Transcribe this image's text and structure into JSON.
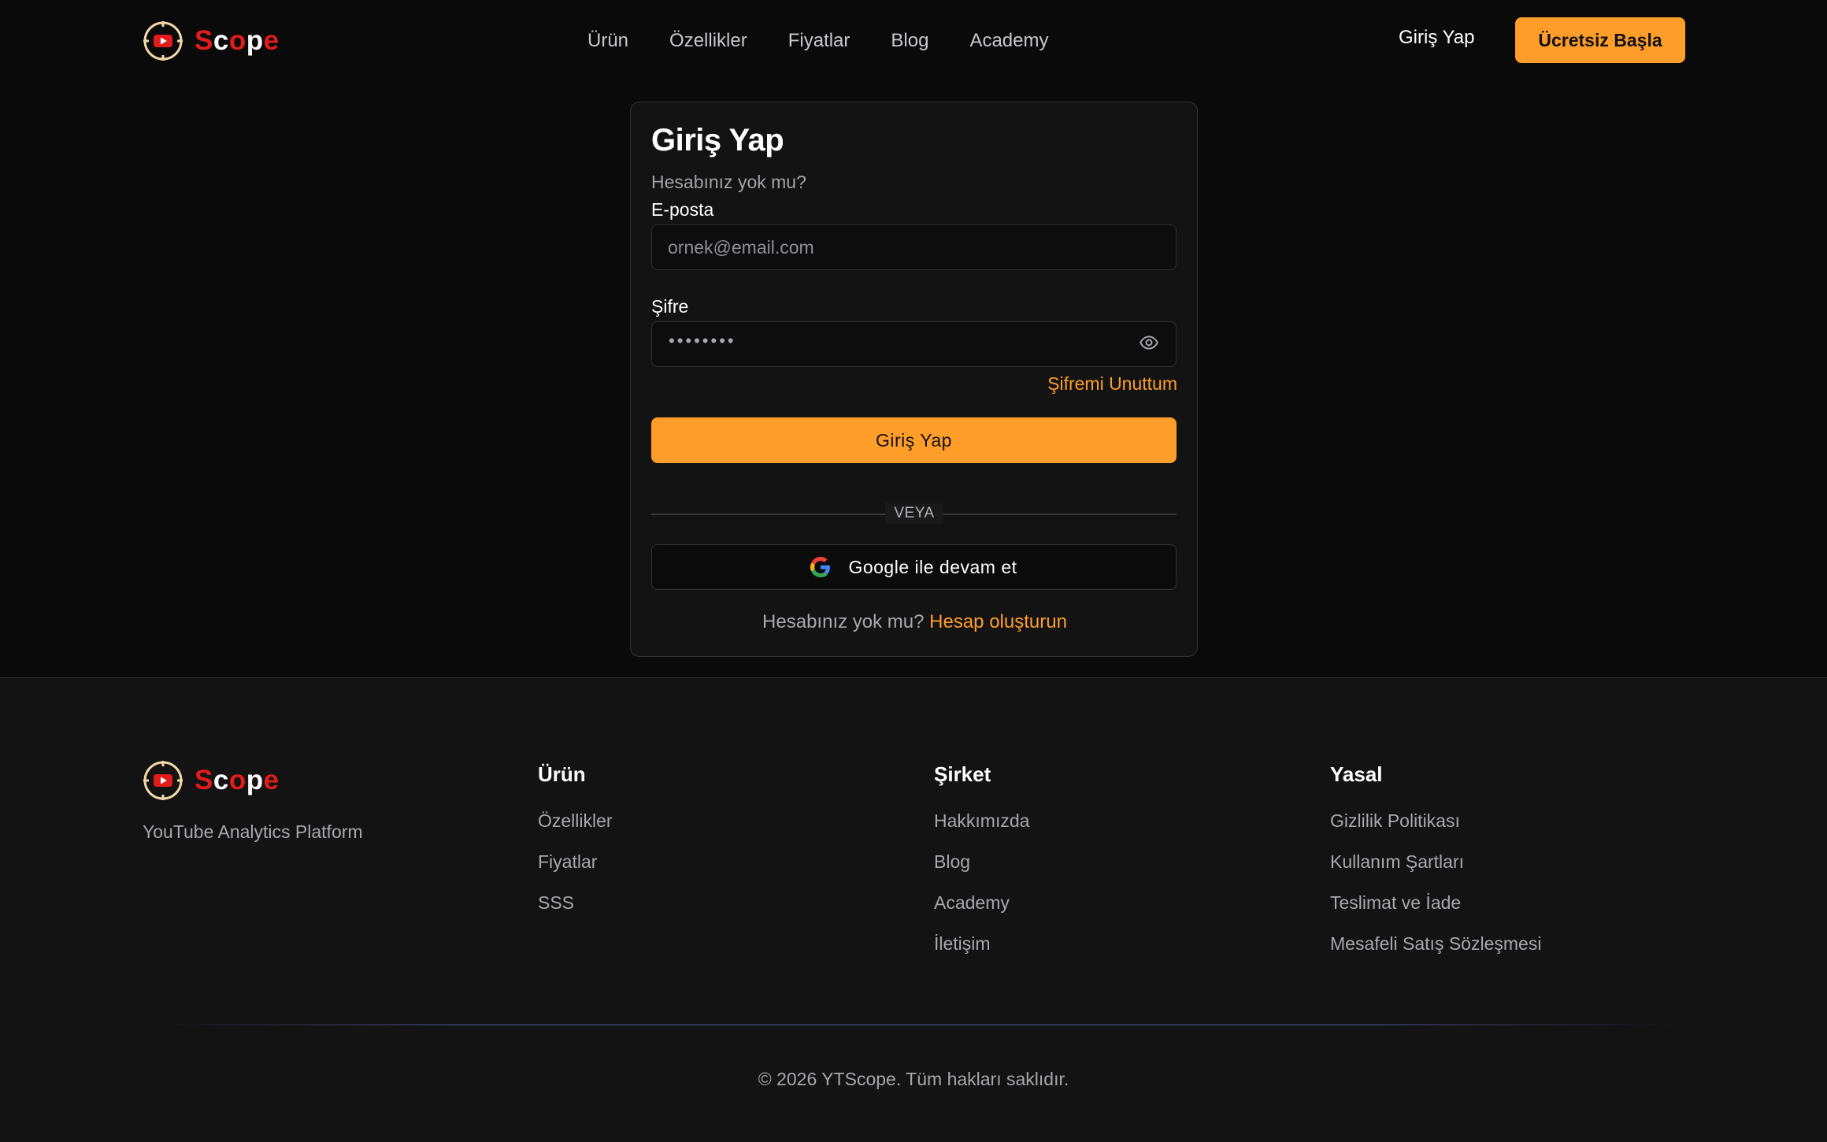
{
  "brand": {
    "name_part1": "S",
    "name_part2": "c",
    "name_part3": "o",
    "name_part4": "p",
    "name_part5": "e",
    "accent_color": "#ff9d2a",
    "brand_red": "#e21b1b"
  },
  "header": {
    "nav": [
      "Ürün",
      "Özellikler",
      "Fiyatlar",
      "Blog",
      "Academy"
    ],
    "login_label": "Giriş Yap",
    "cta_label": "Ücretsiz Başla"
  },
  "login": {
    "title": "Giriş Yap",
    "subtitle": "Hesabınız yok mu?",
    "email_label": "E-posta",
    "email_placeholder": "ornek@email.com",
    "password_label": "Şifre",
    "password_masked": "••••••••",
    "show_password_icon": "eye-icon",
    "forgot_label": "Şifremi Unuttum",
    "submit_label": "Giriş Yap",
    "divider_label": "VEYA",
    "google_label": "Google ile devam et",
    "google_icon": "google-icon",
    "signup_prompt": "Hesabınız yok mu? ",
    "signup_link": "Hesap oluşturun"
  },
  "footer": {
    "tagline": "YouTube Analytics Platform",
    "columns": [
      {
        "title": "Ürün",
        "links": [
          "Özellikler",
          "Fiyatlar",
          "SSS"
        ]
      },
      {
        "title": "Şirket",
        "links": [
          "Hakkımızda",
          "Blog",
          "Academy",
          "İletişim"
        ]
      },
      {
        "title": "Yasal",
        "links": [
          "Gizlilik Politikası",
          "Kullanım Şartları",
          "Teslimat ve İade",
          "Mesafeli Satış Sözleşmesi"
        ]
      }
    ],
    "copyright": "© 2026 YTScope. Tüm hakları saklıdır."
  }
}
